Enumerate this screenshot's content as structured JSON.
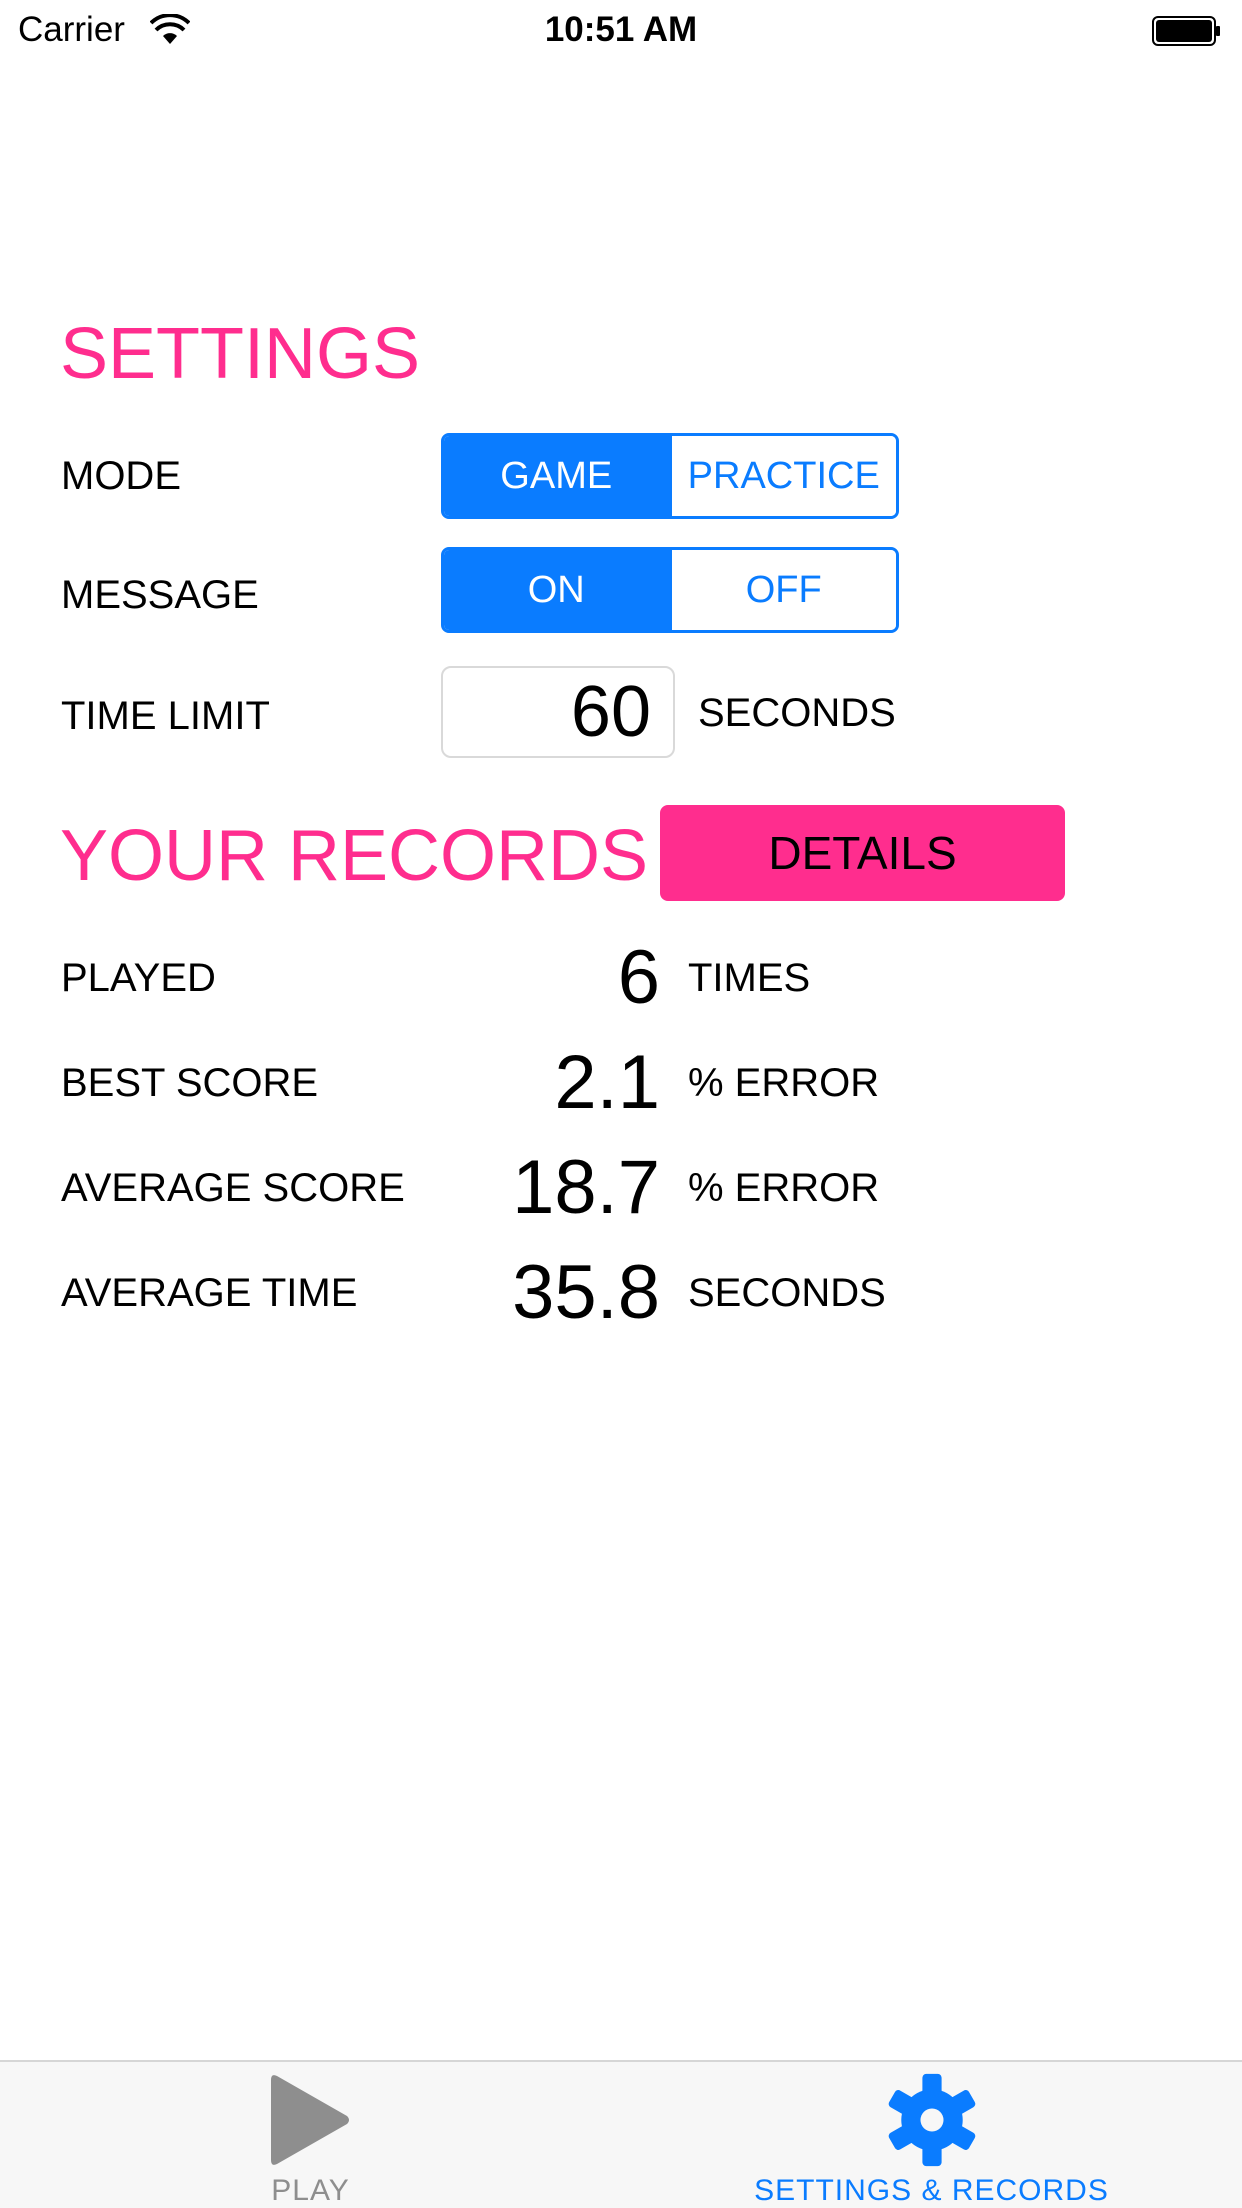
{
  "status_bar": {
    "carrier": "Carrier",
    "time": "10:51 AM"
  },
  "settings": {
    "heading": "SETTINGS",
    "mode": {
      "label": "MODE",
      "options": [
        "GAME",
        "PRACTICE"
      ],
      "selected": "GAME"
    },
    "message": {
      "label": "MESSAGE",
      "options": [
        "ON",
        "OFF"
      ],
      "selected": "ON"
    },
    "time_limit": {
      "label": "TIME LIMIT",
      "value": "60",
      "unit": "SECONDS"
    }
  },
  "records": {
    "heading": "YOUR RECORDS",
    "details_label": "DETAILS",
    "rows": [
      {
        "label": "PLAYED",
        "value": "6",
        "unit": "TIMES"
      },
      {
        "label": "BEST SCORE",
        "value": "2.1",
        "unit": "% ERROR"
      },
      {
        "label": "AVERAGE SCORE",
        "value": "18.7",
        "unit": "% ERROR"
      },
      {
        "label": "AVERAGE TIME",
        "value": "35.8",
        "unit": "SECONDS"
      }
    ]
  },
  "tab_bar": {
    "tabs": [
      {
        "label": "PLAY",
        "icon": "play-icon",
        "active": false
      },
      {
        "label": "SETTINGS & RECORDS",
        "icon": "gear-icon",
        "active": true
      }
    ]
  },
  "colors": {
    "accent_pink": "#ff2d8e",
    "accent_blue": "#0a7cff",
    "inactive_gray": "#8e8e8e"
  }
}
